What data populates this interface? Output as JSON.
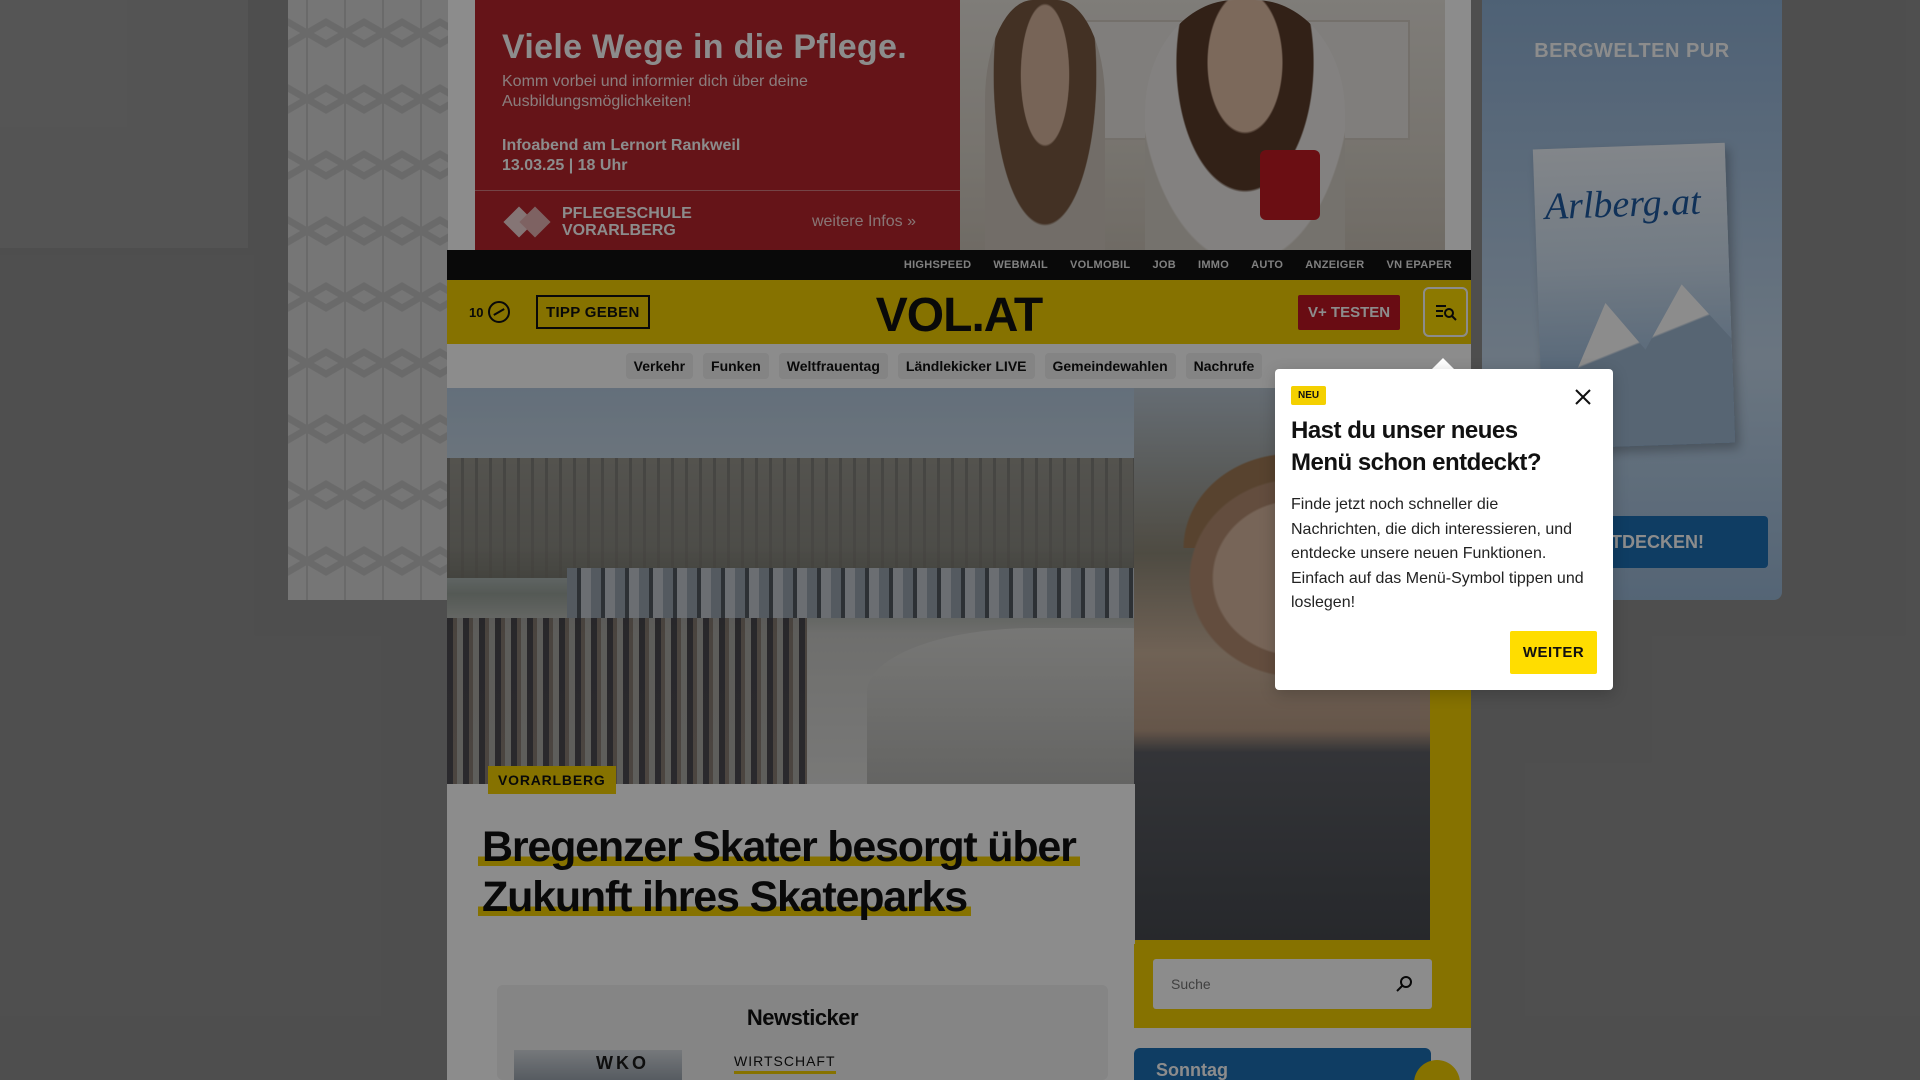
{
  "ad_top": {
    "headline": "Viele Wege in die Pflege.",
    "subline": "Komm vorbei und informier dich über deine Ausbildungsmöglichkeiten!",
    "event": "Infoabend am Lernort Rankweil 13.03.25 | 18 Uhr",
    "school_name": "PFLEGESCHULE VORARLBERG",
    "link": "weitere Infos »"
  },
  "ad_right": {
    "headline": "BERGWELTEN PUR",
    "magazine_title": "Arlberg.at",
    "cta": "ENTDECKEN!"
  },
  "servicebar": {
    "links": [
      "HIGHSPEED",
      "WEBMAIL",
      "VOLMOBIL",
      "JOB",
      "IMMO",
      "AUTO",
      "ANZEIGER",
      "VN EPAPER"
    ]
  },
  "header": {
    "counter": "10",
    "tipp_label": "TIPP GEBEN",
    "logo": "VOL.AT",
    "vplus_label": "V+ TESTEN"
  },
  "topics": [
    "Verkehr",
    "Funken",
    "Weltfrauentag",
    "Ländlekicker LIVE",
    "Gemeindewahlen",
    "Nachrufe"
  ],
  "hero": {
    "tag": "VORARLBERG",
    "headline_line1": "Bregenzer Skater besorgt über",
    "headline_line2": "Zukunft ihres Skateparks"
  },
  "search": {
    "placeholder": "Suche"
  },
  "newsticker": {
    "title": "Newsticker",
    "thumb_text": "WKO",
    "category": "WIRTSCHAFT"
  },
  "blue_card": {
    "label": "Sonntag"
  },
  "popup": {
    "badge": "NEU",
    "title": "Hast du unser neues Menü schon entdeckt?",
    "body": "Finde jetzt noch schneller die Nachrichten, die dich interessieren, und entdecke unsere neuen Funktionen. Einfach auf das Menü-Symbol tippen und loslegen!",
    "button": "WEITER"
  },
  "colors": {
    "brand_yellow": "#f4d000",
    "accent_red": "#c01723",
    "accent_blue": "#1d6fb5",
    "ad_red": "#b8262c"
  }
}
